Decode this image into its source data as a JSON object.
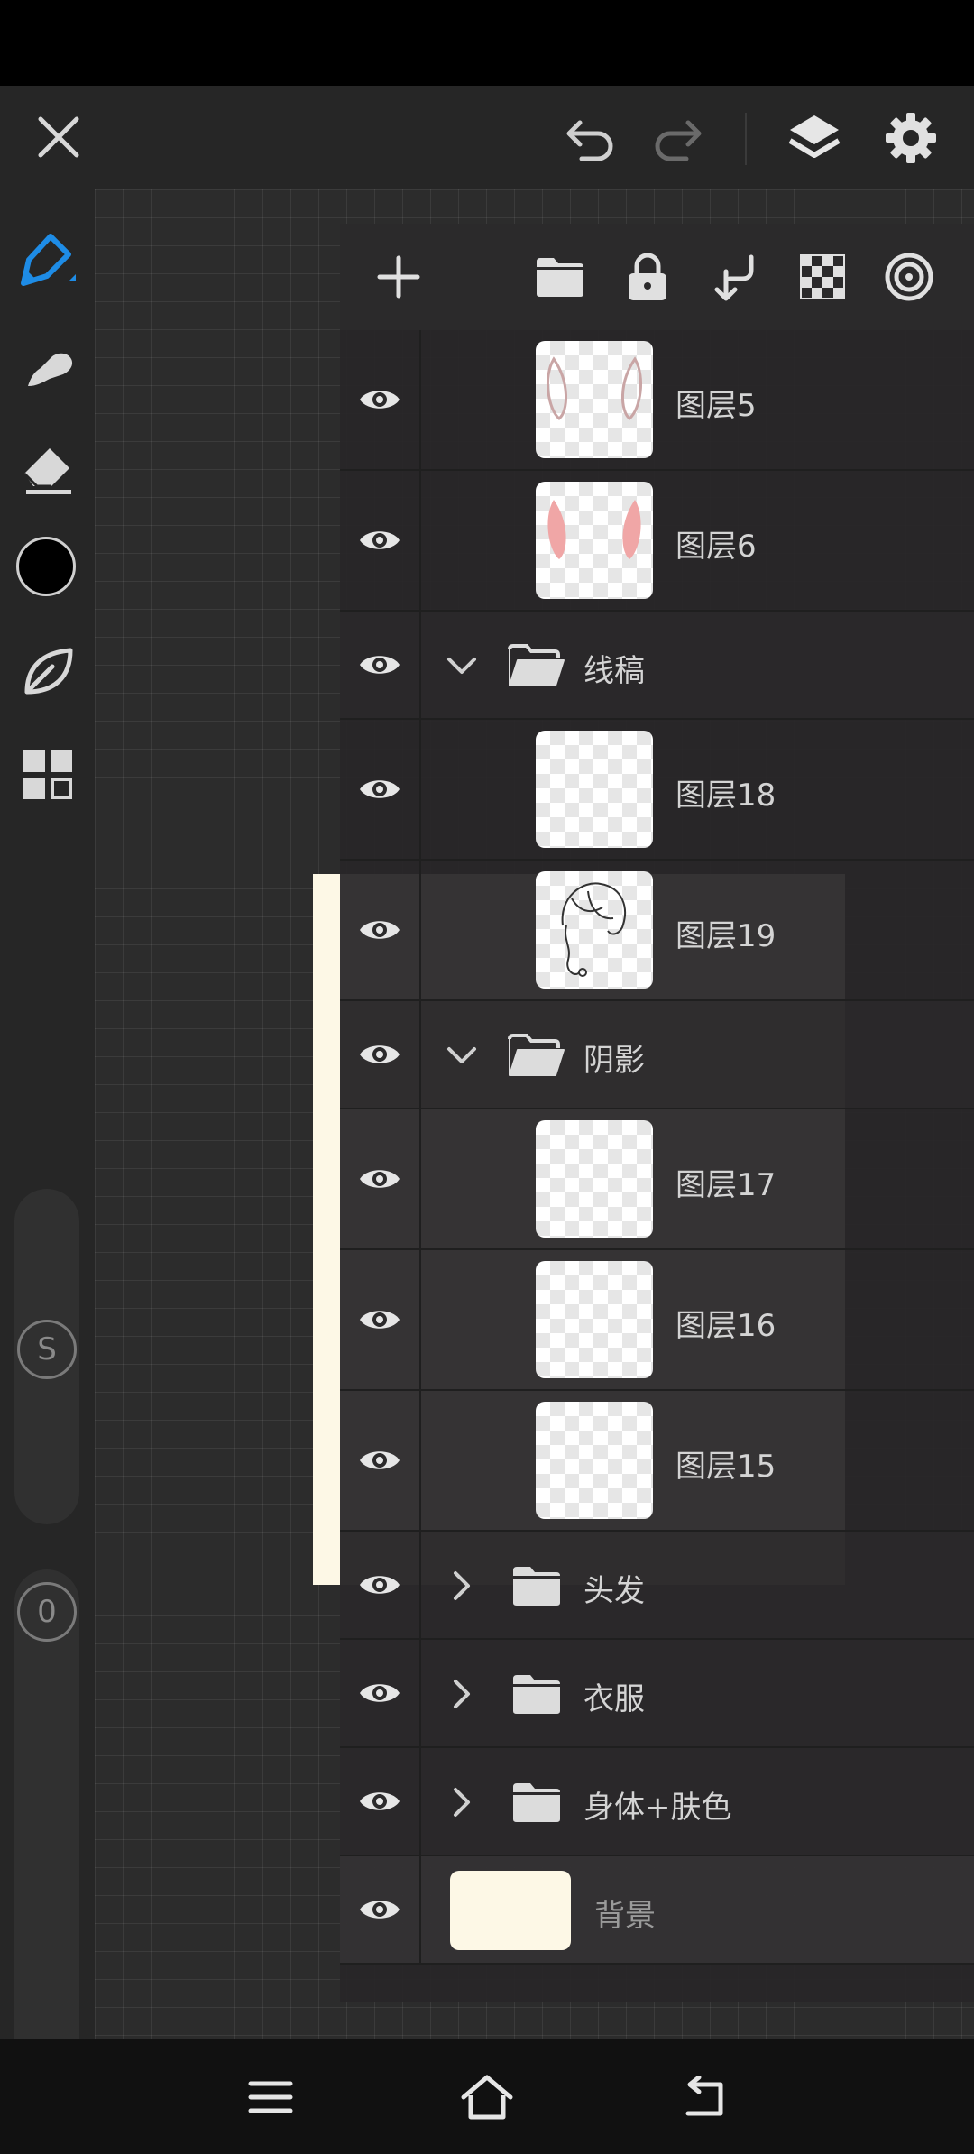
{
  "app": {
    "accent_color": "#1e8ce6",
    "current_color": "#000000"
  },
  "top_bar": {
    "icons": [
      "close-icon",
      "undo-icon",
      "redo-icon",
      "layers-icon",
      "settings-icon"
    ]
  },
  "tools": {
    "items": [
      "pen-icon",
      "smudge-icon",
      "eraser-icon",
      "color-swatch",
      "leaf-icon",
      "grid-icon"
    ],
    "size_slider_label": "S",
    "opacity_slider_label": "0"
  },
  "layer_panel": {
    "toolbar_icons": [
      "add-icon",
      "folder-icon",
      "lock-icon",
      "merge-down-icon",
      "checker-icon",
      "target-icon"
    ],
    "layers": [
      {
        "name": "图层5",
        "kind": "layer",
        "thumb": "rabbit-ears-outline"
      },
      {
        "name": "图层6",
        "kind": "layer",
        "thumb": "rabbit-ears-pink"
      },
      {
        "name": "线稿",
        "kind": "group",
        "expanded": true
      },
      {
        "name": "图层18",
        "kind": "layer",
        "thumb": "blank"
      },
      {
        "name": "图层19",
        "kind": "layer",
        "thumb": "character-sketch"
      },
      {
        "name": "阴影",
        "kind": "group",
        "expanded": true
      },
      {
        "name": "图层17",
        "kind": "layer",
        "thumb": "blank"
      },
      {
        "name": "图层16",
        "kind": "layer",
        "thumb": "blank"
      },
      {
        "name": "图层15",
        "kind": "layer",
        "thumb": "blank"
      },
      {
        "name": "头发",
        "kind": "group",
        "expanded": false
      },
      {
        "name": "衣服",
        "kind": "group",
        "expanded": false
      },
      {
        "name": "身体+肤色",
        "kind": "group",
        "expanded": false
      },
      {
        "name": "背景",
        "kind": "background",
        "color": "#fdf8e6"
      }
    ]
  },
  "bottom_nav": {
    "icons": [
      "menu-icon",
      "home-icon",
      "back-icon"
    ]
  }
}
